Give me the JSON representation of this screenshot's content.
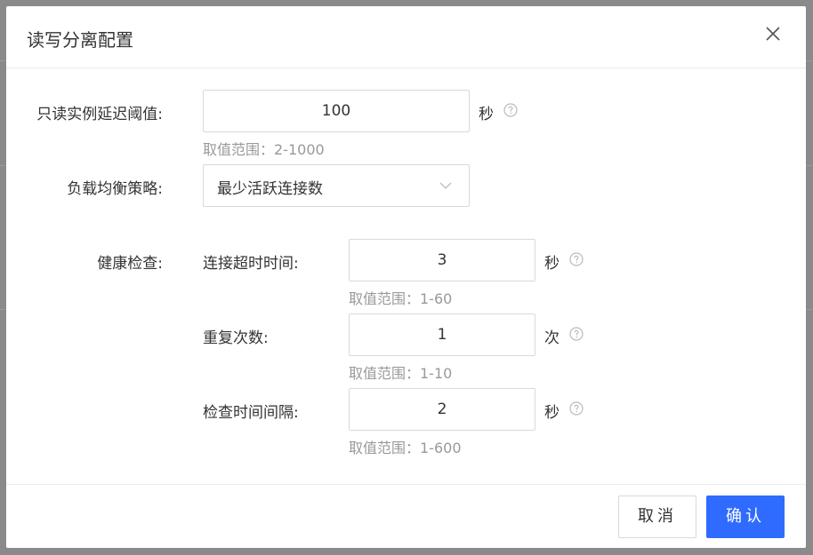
{
  "dialog": {
    "title": "读写分离配置"
  },
  "form": {
    "delay_threshold": {
      "label": "只读实例延迟阈值:",
      "value": "100",
      "unit": "秒",
      "hint": "取值范围：2-1000"
    },
    "lb_strategy": {
      "label": "负载均衡策略:",
      "selected": "最少活跃连接数"
    },
    "health_check": {
      "label": "健康检查:",
      "timeout": {
        "label": "连接超时时间:",
        "value": "3",
        "unit": "秒",
        "hint": "取值范围：1-60"
      },
      "retries": {
        "label": "重复次数:",
        "value": "1",
        "unit": "次",
        "hint": "取值范围：1-10"
      },
      "interval": {
        "label": "检查时间间隔:",
        "value": "2",
        "unit": "秒",
        "hint": "取值范围：1-600"
      }
    }
  },
  "footer": {
    "cancel_label": "取消",
    "confirm_label": "确认"
  },
  "colors": {
    "primary": "#2f6bff",
    "hint": "#999999",
    "border": "#d9d9d9"
  },
  "icons": {
    "close": "close-icon",
    "help": "question-circle-icon",
    "dropdown": "chevron-down-icon"
  }
}
